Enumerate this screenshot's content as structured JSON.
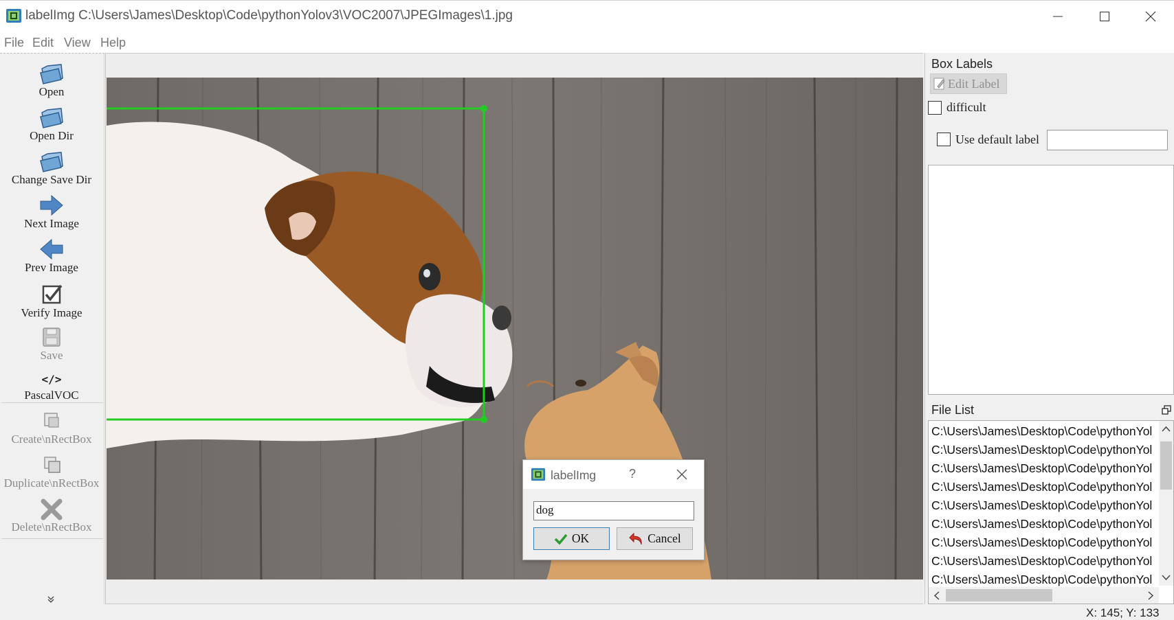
{
  "window": {
    "title": "labelImg C:\\Users\\James\\Desktop\\Code\\pythonYolov3\\VOC2007\\JPEGImages\\1.jpg"
  },
  "menu": {
    "file": "File",
    "edit": "Edit",
    "view": "View",
    "help": "Help"
  },
  "toolbar": {
    "open": "Open",
    "open_dir": "Open Dir",
    "change_save_dir": "Change Save Dir",
    "next_image": "Next Image",
    "prev_image": "Prev Image",
    "verify_image": "Verify Image",
    "save": "Save",
    "format_symbol": "</>",
    "format": "PascalVOC",
    "create_rectbox": "Create\\nRectBox",
    "duplicate_rectbox": "Duplicate\\nRectBox",
    "delete_rectbox": "Delete\\nRectBox",
    "more": "»"
  },
  "box_labels": {
    "title": "Box Labels",
    "edit_label": "Edit Label",
    "difficult": "difficult",
    "use_default_label": "Use default label",
    "default_label_value": ""
  },
  "file_list": {
    "title": "File List",
    "items": [
      "C:\\Users\\James\\Desktop\\Code\\pythonYol",
      "C:\\Users\\James\\Desktop\\Code\\pythonYol",
      "C:\\Users\\James\\Desktop\\Code\\pythonYol",
      "C:\\Users\\James\\Desktop\\Code\\pythonYol",
      "C:\\Users\\James\\Desktop\\Code\\pythonYol",
      "C:\\Users\\James\\Desktop\\Code\\pythonYol",
      "C:\\Users\\James\\Desktop\\Code\\pythonYol",
      "C:\\Users\\James\\Desktop\\Code\\pythonYol",
      "C:\\Users\\James\\Desktop\\Code\\pythonYol"
    ]
  },
  "dialog": {
    "title": "labelImg",
    "help": "?",
    "input_value": "dog",
    "ok": "OK",
    "cancel": "Cancel"
  },
  "status": {
    "coords": "X: 145; Y: 133"
  },
  "colors": {
    "bbox": "#22cc22",
    "dialog_ok_border": "#3c7fb1"
  }
}
